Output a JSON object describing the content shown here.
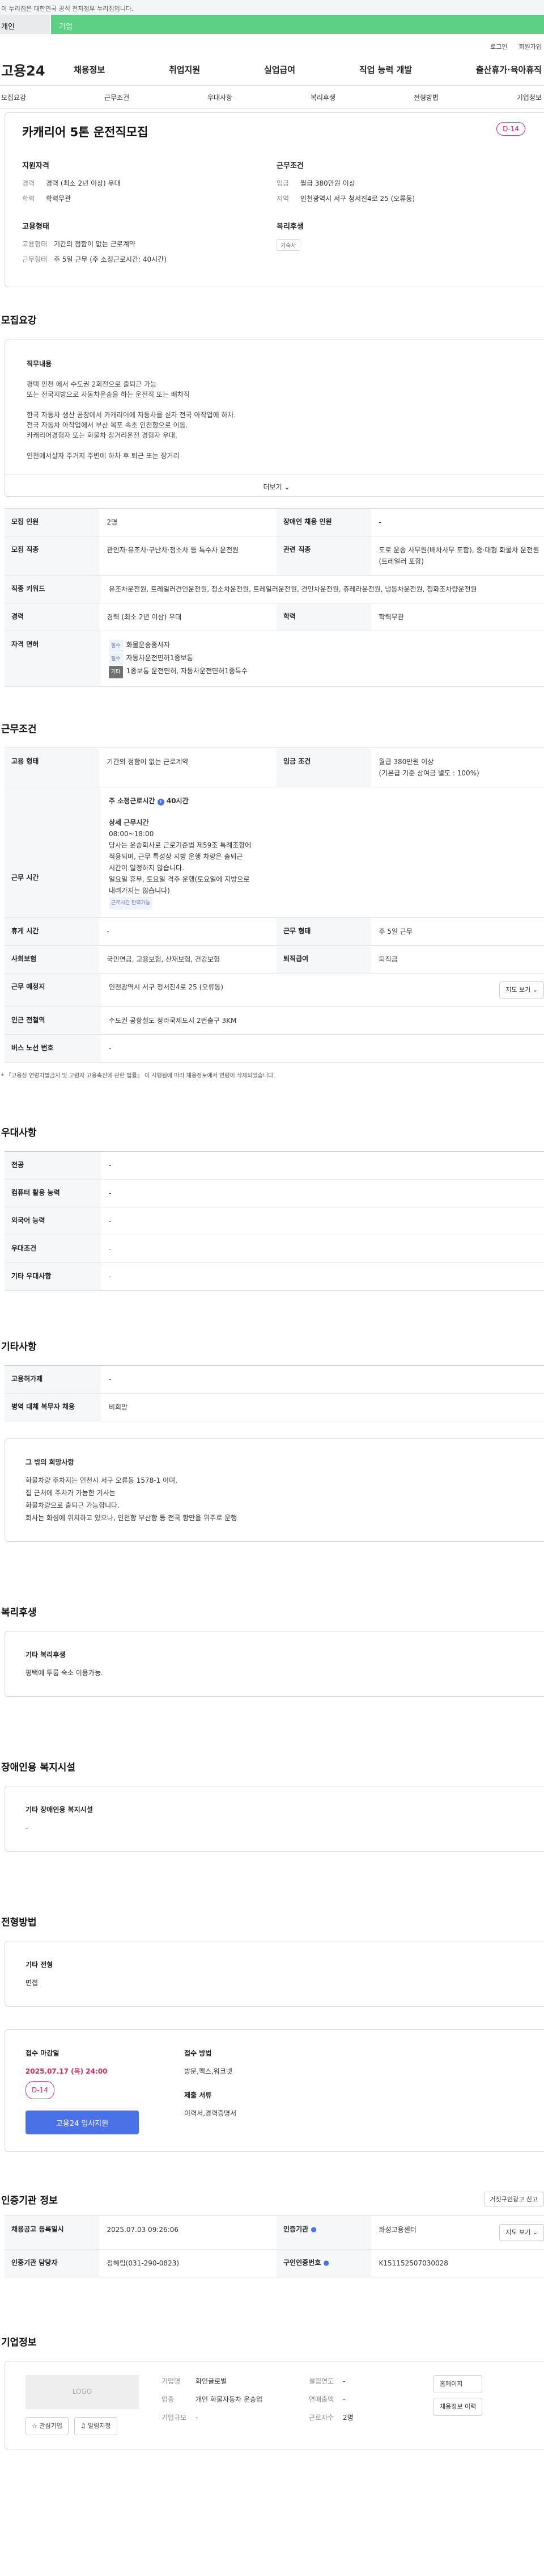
{
  "topbar": {
    "notice": "이 누리집은 대한민국 공식 전자정부 누리집입니다."
  },
  "tabs": [
    {
      "label": "개인"
    },
    {
      "label": "기업"
    }
  ],
  "utility": [
    {
      "label": "로그인"
    },
    {
      "label": "회원가입"
    }
  ],
  "brand": {
    "logo": "고용24"
  },
  "gnb": [
    "채용정보",
    "취업지원",
    "실업급여",
    "직업 능력 개발",
    "출산휴가·육아휴직"
  ],
  "anchors": [
    "모집요강",
    "근무조건",
    "우대사항",
    "복리후생",
    "전형방법",
    "기업정보"
  ],
  "summary": {
    "title": "카캐리어 5톤 운전직모집",
    "dday": "D-14",
    "qualification": {
      "label": "지원자격",
      "career_k": "경력",
      "career_v": "경력 (최소 2년 이상) 우대",
      "edu_k": "학력",
      "edu_v": "학력무관"
    },
    "employment": {
      "label": "고용형태",
      "type_k": "고용형태",
      "type_v": "기간의 정함이 없는 근로계약",
      "hours_k": "근무형태",
      "hours_v": "주 5일 근무 (주 소정근로시간: 40시간)"
    },
    "conditions": {
      "label": "근무조건",
      "pay_k": "임금",
      "pay_v": "월급 380만원 이상",
      "region_k": "지역",
      "region_v": "인천광역시 서구 청서진4로 25 (오류동)"
    },
    "welfare": {
      "label": "복리후생",
      "chip": "기숙사"
    }
  },
  "recruit": {
    "section_title": "모집요강",
    "desc_head": "직무내용",
    "desc_lines": [
      "평택 인천 에서 수도권 2회전으로 출퇴근 가능",
      "또는 전국지방으로 자동차운송을 하는 운전직 또는 배차직",
      "",
      "한국 자동차 생산 공장에서 카캐리어에 자동차를 싣자 전국 아작업에 하차.",
      "전국 자동차 아작업에서 부산 목포 속초 인천항으로 이동.",
      "카캐리어경험자 또는 화물차 장거리운전 경험자 우대.",
      "",
      "인천에서살자 주거지 주변에 하차 후 퇴근 또는 장거리"
    ],
    "more": "더보기",
    "rows": {
      "count_k": "모집 인원",
      "count_v": "2명",
      "disabled_k": "장애인 채용 인원",
      "disabled_v": "-",
      "job_k": "모집 직종",
      "job_v": "관인자·유조차·구난차·청소차 등 특수차 운전원",
      "related_k": "관련 직종",
      "related_v": "도로 운송 사무원(배차사무 포함), 중·대형 화물차 운전원(트레일러 포함)",
      "keyword_k": "직종 키워드",
      "keyword_v": "유조차운전원, 트레일러견인운전원, 청소차운전원, 트레일러운전원, 견인차운전원, 츄레라운전원, 냉동차운전원, 청화조차량운전원",
      "career_k": "경력",
      "career_v": "경력 (최소 2년 이상) 우대",
      "edu_k": "학력",
      "edu_v": "학력무관",
      "license_k": "자격 면허",
      "licenses": [
        {
          "tag": "필수",
          "name": "화물운송종사자"
        },
        {
          "tag": "필수",
          "name": "자동차운전면허1종보통"
        },
        {
          "tag": "기타",
          "name": "1종보통 운전면허, 자동차운전면허1종특수"
        }
      ]
    }
  },
  "work": {
    "section_title": "근무조건",
    "type_k": "고용 형태",
    "type_v": "기간의 정함이 없는 근로계약",
    "pay_k": "임금 조건",
    "pay_v1": "월급 380만원 이상",
    "pay_v2": "(기본급 기준 상여금 별도 : 100%)",
    "time_k": "근무 시간",
    "time_head": "주 소정근로시간",
    "time_hours": "40시간",
    "time_detail_head": "상세 근무시간",
    "time_detail": "08:00~18:00",
    "time_lines": [
      "당사는 운송회사로 근로기준법 제59조 특례조항에",
      "적용되며, 근무 특성상 지방 운행 차량은 출퇴근",
      "시간이 일정하지 않습니다.",
      "일요일 휴무, 토요일 격주 운행(토요일에 지방으로",
      "내려가지는 않습니다)"
    ],
    "time_tag": "근로시간 탄력가능",
    "rest_k": "휴게 시간",
    "rest_v": "-",
    "form_k": "근무 형태",
    "form_v": "주 5일 근무",
    "insurance_k": "사회보험",
    "insurance_v": "국민연금, 고용보험, 산재보험, 건강보험",
    "severance_k": "퇴직급여",
    "severance_v": "퇴직금",
    "place_k": "근무 예정지",
    "place_v": "인천광역시 서구 청서진4로 25 (오류동)",
    "map_btn": "지도 보기",
    "subway_k": "인근 전철역",
    "subway_v": "수도권 공항철도 청라국제도시 2번출구 3KM",
    "bus_k": "버스 노선 번호",
    "bus_v": "-",
    "note": "* 『고용상 연령차별금지 및 고령자 고용촉진에 관한 법률』 이 시행됨에 따라 채용정보에서 연령이 삭제되었습니다."
  },
  "pref": {
    "section_title": "우대사항",
    "rows": [
      {
        "k": "전공",
        "v": "-"
      },
      {
        "k": "컴퓨터 활용 능력",
        "v": "-"
      },
      {
        "k": "외국어 능력",
        "v": "-"
      },
      {
        "k": "우대조건",
        "v": "-"
      },
      {
        "k": "기타 우대사항",
        "v": "-"
      }
    ]
  },
  "etc": {
    "section_title": "기타사항",
    "rows": [
      {
        "k": "고용허가제",
        "v": "-"
      },
      {
        "k": "병역 대체 복무자 채용",
        "v": "비희망"
      }
    ],
    "box_head": "그 밖의 희망사항",
    "box_lines": [
      "화물차량 주차지는 인천시 서구 오류동 1578-1 이며,",
      "집 근처에 주차가 가능한 기사는",
      "화물차량으로 출퇴근 가능합니다.",
      "회사는 화성에 위치하고 있으나, 인천항 부산항 등 전국 항만을 위주로 운행"
    ]
  },
  "welfare": {
    "section_title": "복리후생",
    "head": "기타 복리후생",
    "text": "평택에 투룸 숙소 이용가능."
  },
  "disabled_fac": {
    "section_title": "장애인용 복지시설",
    "head": "기타 장애인용 복지시설",
    "text": "-"
  },
  "process": {
    "section_title": "전형방법",
    "head": "기타 전형",
    "text": "면접"
  },
  "apply": {
    "deadline_label": "접수 마감일",
    "deadline": "2025.07.17 (목) 24:00",
    "dday": "D-14",
    "btn": "고용24 입사지원",
    "method_label": "접수 방법",
    "method": "방문,팩스,워크넷",
    "docs_label": "제출 서류",
    "docs": "이력서,경력증명서"
  },
  "agency": {
    "section_title": "인증기관 정보",
    "report_btn": "거짓구인광고 신고",
    "reg_k": "채용공고 등록일시",
    "reg_v": "2025.07.03 09:26:06",
    "org_k": "인증기관",
    "org_v": "화성고용센터",
    "map_btn": "지도 보기",
    "staff_k": "인증기관 담당자",
    "staff_v": "정혜림(031-290-0823)",
    "num_k": "구인인증번호",
    "num_v": "K151152507030028"
  },
  "company": {
    "section_title": "기업정보",
    "logo": "LOGO",
    "fav": "관심기업",
    "notice": "알림지정",
    "name_k": "기업명",
    "name_v": "화인글로벌",
    "ind_k": "업종",
    "ind_v": "개인 화물자동차 운송업",
    "size_k": "기업규모",
    "size_v": "-",
    "est_k": "설립연도",
    "est_v": "-",
    "rev_k": "연매출액",
    "rev_v": "-",
    "emp_k": "근로자수",
    "emp_v": "2명",
    "home_btn": "홈페이지",
    "jobs_btn": "채용정보 이력"
  }
}
